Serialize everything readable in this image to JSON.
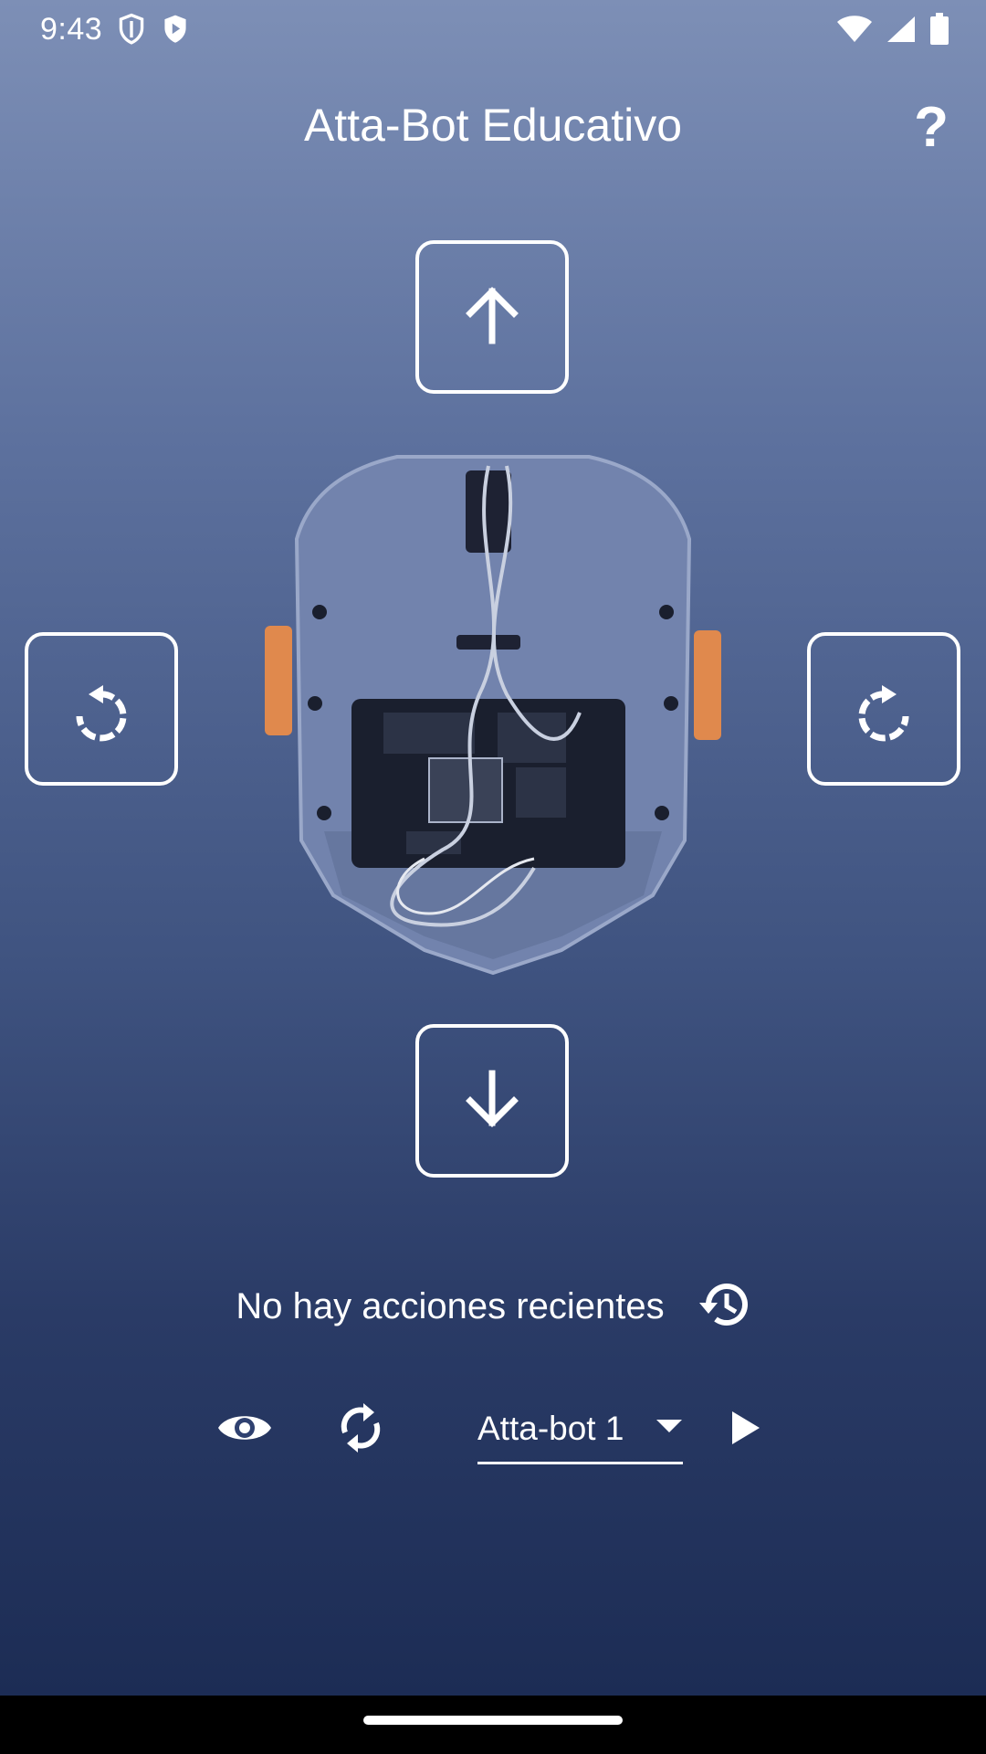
{
  "status_bar": {
    "time": "9:43",
    "left_icons": [
      "shield-outline-icon",
      "shield-filled-icon"
    ],
    "right_icons": [
      "wifi-icon",
      "signal-icon",
      "battery-icon"
    ]
  },
  "header": {
    "title": "Atta-Bot Educativo",
    "help_label": "?"
  },
  "controls": {
    "forward_icon": "arrow-up-icon",
    "backward_icon": "arrow-down-icon",
    "rotate_left_icon": "rotate-left-icon",
    "rotate_right_icon": "rotate-right-icon"
  },
  "robot_image": {
    "description_icon": "robot-chassis-image"
  },
  "recent": {
    "text": "No hay acciones recientes",
    "icon": "history-icon"
  },
  "bottom": {
    "view_icon": "eye-icon",
    "sync_icon": "sync-icon",
    "selected_robot": "Atta-bot 1",
    "dropdown_icon": "caret-down-icon",
    "play_icon": "play-icon"
  },
  "colors": {
    "gradient_top": "#7d8fb6",
    "gradient_bottom": "#1a2a52",
    "accent_orange": "#e0894d"
  }
}
